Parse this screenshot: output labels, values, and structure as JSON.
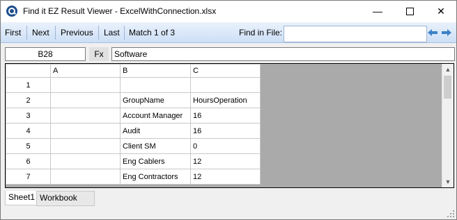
{
  "window": {
    "title": "Find it EZ Result Viewer - ExcelWithConnection.xlsx",
    "minimize": "—",
    "close": "✕"
  },
  "toolbar": {
    "first": "First",
    "next": "Next",
    "previous": "Previous",
    "last": "Last",
    "match": "Match 1 of 3",
    "find_label": "Find in File:",
    "find_value": ""
  },
  "formula_bar": {
    "cell_ref": "B28",
    "fx_label": "Fx",
    "value": "Software"
  },
  "grid": {
    "columns": [
      "A",
      "B",
      "C"
    ],
    "rows": [
      {
        "num": "1",
        "a": "",
        "b": "",
        "c": ""
      },
      {
        "num": "2",
        "a": "",
        "b": "GroupName",
        "c": "HoursOperation"
      },
      {
        "num": "3",
        "a": "",
        "b": "Account Manager",
        "c": "16"
      },
      {
        "num": "4",
        "a": "",
        "b": "Audit",
        "c": "16"
      },
      {
        "num": "5",
        "a": "",
        "b": "Client SM",
        "c": "0"
      },
      {
        "num": "6",
        "a": "",
        "b": "Eng Cablers",
        "c": "12"
      },
      {
        "num": "7",
        "a": "",
        "b": "Eng Contractors",
        "c": "12"
      }
    ]
  },
  "tabs": [
    "Sheet1",
    "Workbook Info"
  ],
  "colors": {
    "toolbar_top": "#e9f1fc",
    "toolbar_bottom": "#cddff6",
    "arrow_blue": "#3c82c8",
    "grid_empty": "#aaaaaa"
  }
}
